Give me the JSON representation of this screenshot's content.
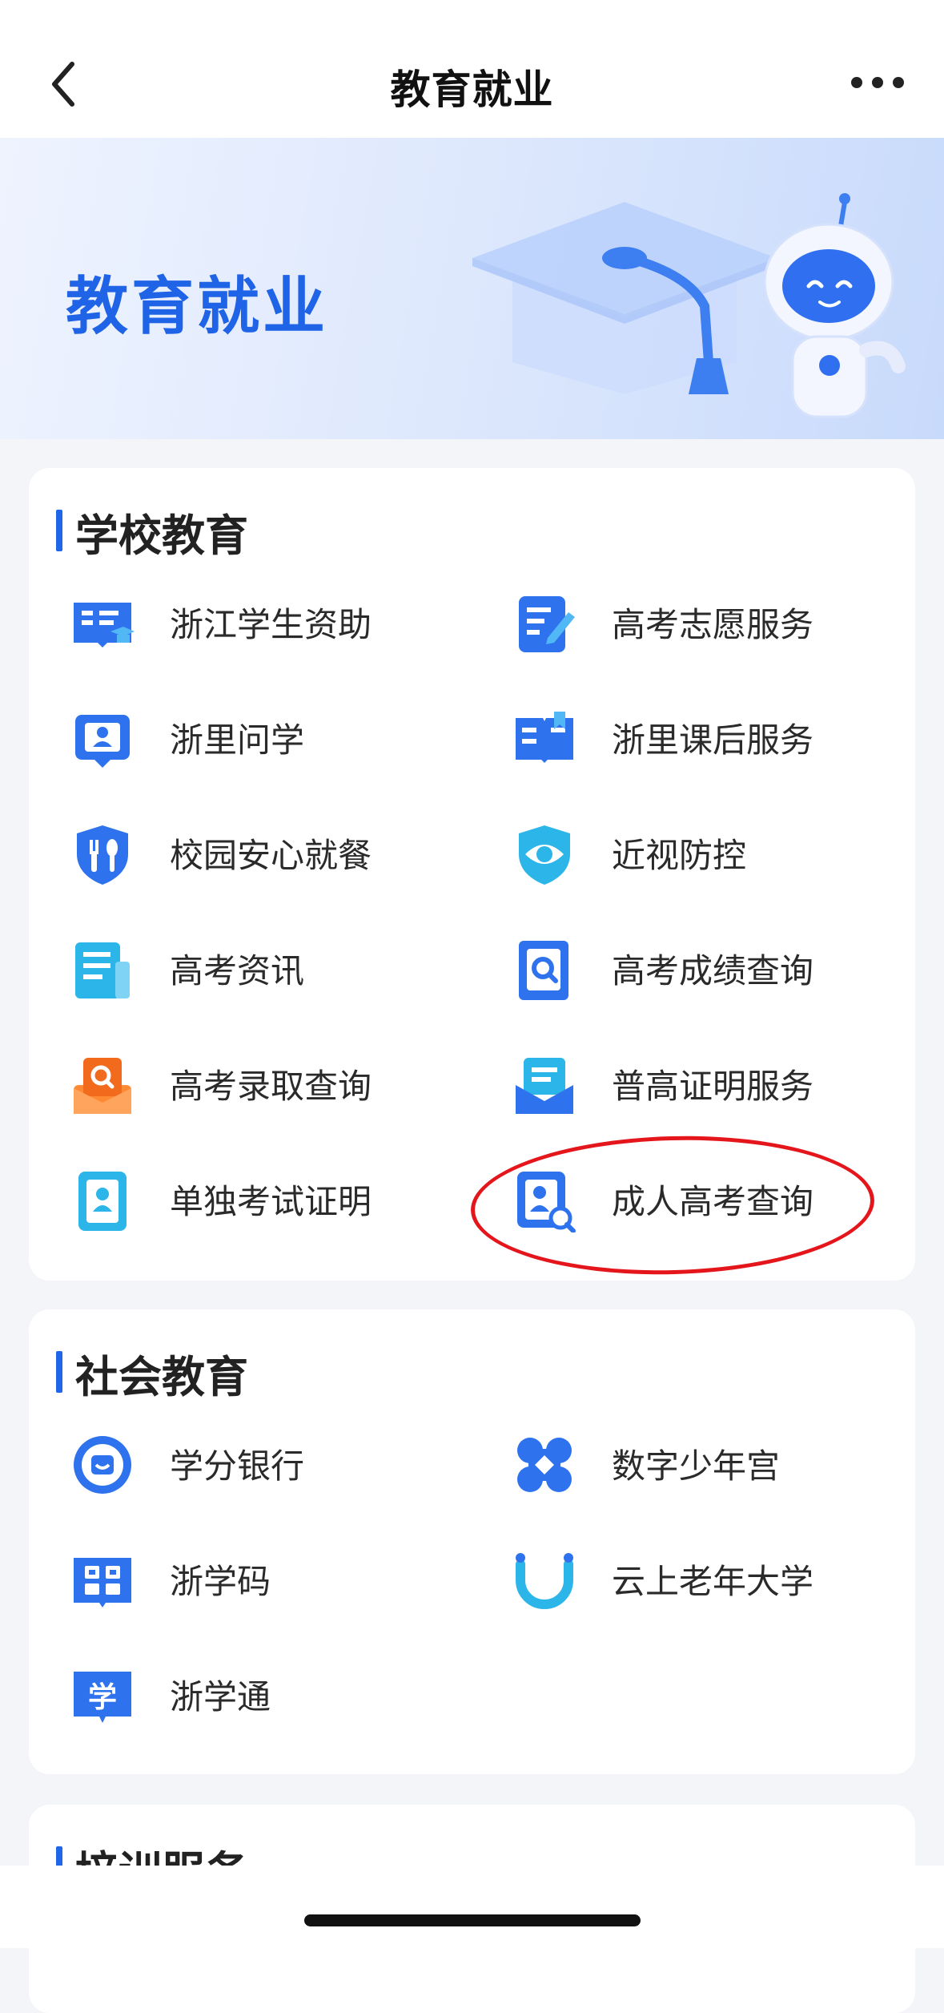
{
  "navbar": {
    "title": "教育就业"
  },
  "hero": {
    "title": "教育就业"
  },
  "school": {
    "title": "学校教育",
    "items": [
      {
        "label": "浙江学生资助",
        "icon": "student-aid-book-icon"
      },
      {
        "label": "高考志愿服务",
        "icon": "application-form-pen-icon"
      },
      {
        "label": "浙里问学",
        "icon": "certificate-person-icon"
      },
      {
        "label": "浙里课后服务",
        "icon": "open-book-bookmark-icon"
      },
      {
        "label": "校园安心就餐",
        "icon": "shield-fork-knife-icon"
      },
      {
        "label": "近视防控",
        "icon": "shield-eye-icon"
      },
      {
        "label": "高考资讯",
        "icon": "news-document-icon"
      },
      {
        "label": "高考成绩查询",
        "icon": "score-search-icon"
      },
      {
        "label": "高考录取查询",
        "icon": "admission-envelope-icon"
      },
      {
        "label": "普高证明服务",
        "icon": "certificate-envelope-icon"
      },
      {
        "label": "单独考试证明",
        "icon": "id-badge-icon"
      },
      {
        "label": "成人高考查询",
        "icon": "certificate-magnifier-icon"
      }
    ]
  },
  "social": {
    "title": "社会教育",
    "items": [
      {
        "label": "学分银行",
        "icon": "credit-bank-coin-icon"
      },
      {
        "label": "数字少年宫",
        "icon": "puzzle-cross-icon"
      },
      {
        "label": "浙学码",
        "icon": "qr-code-book-icon"
      },
      {
        "label": "云上老年大学",
        "icon": "smile-horseshoe-icon"
      },
      {
        "label": "浙学通",
        "icon": "study-character-icon"
      }
    ]
  },
  "train": {
    "title": "培训服务"
  },
  "colors": {
    "accent": "#2066e8",
    "highlight": "#e5161b",
    "heroTitle": "#1f63e6"
  }
}
